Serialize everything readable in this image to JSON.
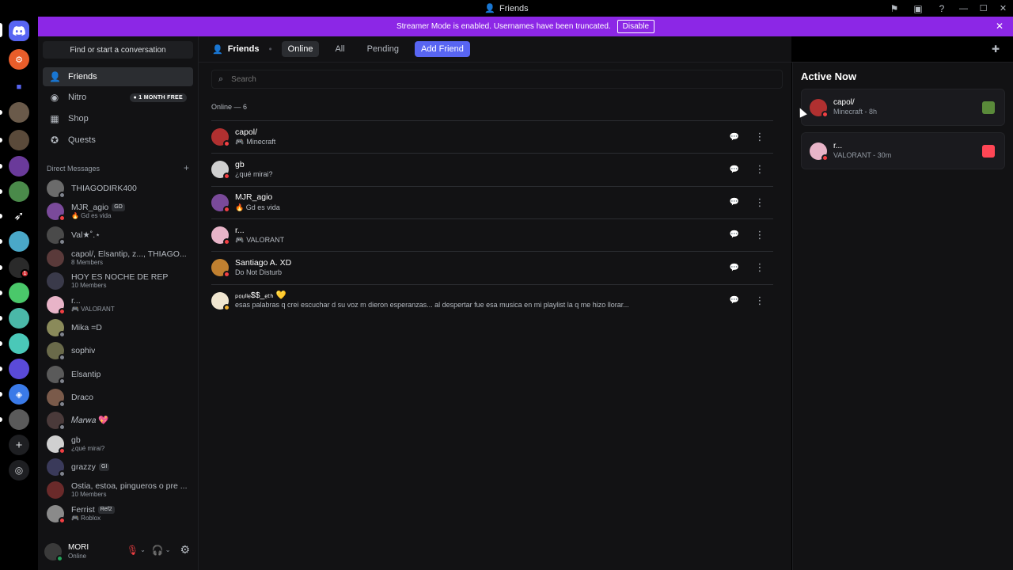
{
  "window": {
    "title": "Friends"
  },
  "banner": {
    "message": "Streamer Mode is enabled. Usernames have been truncated.",
    "disable_label": "Disable"
  },
  "sidebar": {
    "find_placeholder": "Find or start a conversation",
    "nav": [
      {
        "label": "Friends",
        "icon": "friends-icon",
        "active": true
      },
      {
        "label": "Nitro",
        "icon": "nitro-icon",
        "badge": "1 MONTH FREE"
      },
      {
        "label": "Shop",
        "icon": "shop-icon"
      },
      {
        "label": "Quests",
        "icon": "quests-icon"
      }
    ],
    "dm_header": "Direct Messages",
    "dms": [
      {
        "name": "THIAGODIRK400",
        "sub": "",
        "status": "off",
        "color": "#6b6b6b"
      },
      {
        "name": "MJR_agio",
        "tag": "GD",
        "sub": "🔥 Gd es vida",
        "status": "dnd",
        "color": "#7a4a9a"
      },
      {
        "name": "Val★˚.⋆",
        "sub": "",
        "status": "off",
        "color": "#4a4a4a"
      },
      {
        "name": "capol/, Elsantip, z..., THIAGO...",
        "sub": "8 Members",
        "status": "",
        "color": "#5a3a3a"
      },
      {
        "name": "HOY ES NOCHE DE REP",
        "sub": "10 Members",
        "status": "",
        "color": "#3a3a4a"
      },
      {
        "name": "r...",
        "sub": "🎮 VALORANT",
        "status": "dnd",
        "color": "#e8b4c8"
      },
      {
        "name": "Mika =D",
        "sub": "",
        "status": "off",
        "color": "#8a8a5a"
      },
      {
        "name": "sophiv",
        "sub": "",
        "status": "off",
        "color": "#6a6a4a"
      },
      {
        "name": "Elsantip",
        "sub": "",
        "status": "off",
        "color": "#5a5a5a"
      },
      {
        "name": "Draco",
        "sub": "",
        "status": "off",
        "color": "#7a5a4a"
      },
      {
        "name": "𝑀𝑎𝑟𝑤𝑎 💖",
        "sub": "",
        "status": "off",
        "color": "#4a3a3a"
      },
      {
        "name": "gb",
        "sub": "¿qué mirai?",
        "status": "dnd",
        "color": "#d0d0d0"
      },
      {
        "name": "grazzy",
        "tag": "GI",
        "sub": "",
        "status": "off",
        "color": "#3a3a5a"
      },
      {
        "name": "Ostia, estoa, pingueros o pre ...",
        "sub": "10 Members",
        "status": "",
        "color": "#6a2a2a"
      },
      {
        "name": "Ferrist",
        "tag": "Ref2",
        "sub": "🎮 Roblox",
        "status": "dnd",
        "color": "#8a8a8a"
      }
    ]
  },
  "user": {
    "name": "MORI",
    "status": "Online"
  },
  "main": {
    "title": "Friends",
    "tabs": [
      {
        "label": "Online",
        "active": true
      },
      {
        "label": "All"
      },
      {
        "label": "Pending"
      }
    ],
    "add_friend": "Add Friend",
    "search_placeholder": "Search",
    "online_header": "Online — 6",
    "friends": [
      {
        "name": "capol/",
        "sub": "Minecraft",
        "gamepad": true,
        "status": "dnd",
        "color": "#b03030"
      },
      {
        "name": "gb",
        "sub": "¿qué mirai?",
        "gamepad": false,
        "status": "dnd",
        "color": "#d0d0d0"
      },
      {
        "name": "MJR_agio",
        "sub": "🔥 Gd es vida",
        "gamepad": false,
        "status": "dnd",
        "color": "#7a4a9a"
      },
      {
        "name": "r...",
        "sub": "VALORANT",
        "gamepad": true,
        "status": "dnd",
        "color": "#e8b4c8"
      },
      {
        "name": "Santiago A. XD",
        "sub": "Do Not Disturb",
        "gamepad": false,
        "status": "dnd",
        "color": "#c08030"
      },
      {
        "name": "ₚₒᵤₗₗₑ$$_ₑₜₕ 💛",
        "sub": "esas palabras q crei escuchar d su voz m dieron esperanzas... al despertar fue esa musica en mi playlist la q me hizo llorar...",
        "gamepad": false,
        "status": "idle",
        "color": "#f0e6d0"
      }
    ]
  },
  "active_now": {
    "title": "Active Now",
    "cards": [
      {
        "name": "capol/",
        "sub": "Minecraft - 8h",
        "color": "#b03030",
        "game_color": "#5a8a3a"
      },
      {
        "name": "r...",
        "sub": "VALORANT - 30m",
        "color": "#e8b4c8",
        "game_color": "#ff4655"
      }
    ]
  }
}
